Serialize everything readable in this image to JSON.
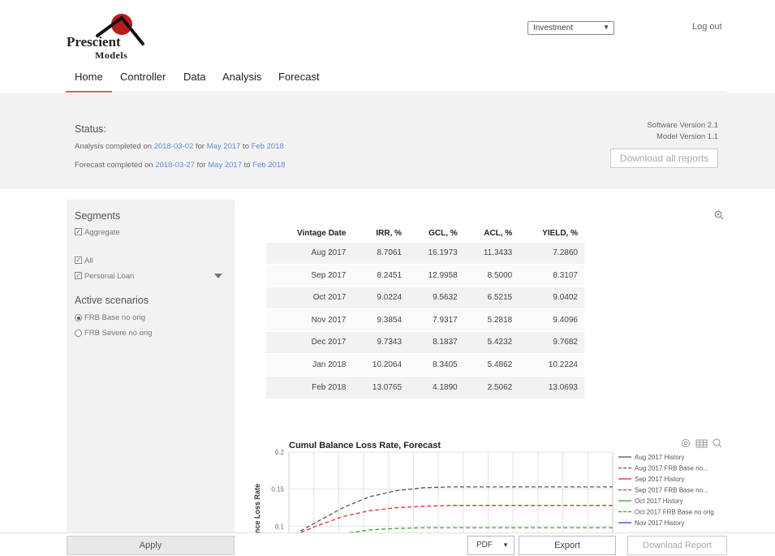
{
  "brand": {
    "name": "Prescient",
    "sub": "Models"
  },
  "header": {
    "selector_value": "Investment",
    "logout": "Log out"
  },
  "nav": {
    "items": [
      "Home",
      "Controller",
      "Data",
      "Analysis",
      "Forecast"
    ],
    "active": "Home"
  },
  "status": {
    "title": "Status:",
    "analysis": {
      "prefix": "Analysis completed on ",
      "date": "2018-03-02",
      "mid": " for ",
      "from": "May 2017",
      "to_word": " to ",
      "to": "Feb 2018"
    },
    "forecast": {
      "prefix": "Forecast completed on ",
      "date": "2018-03-27",
      "mid": " for ",
      "from": "May 2017",
      "to_word": " to ",
      "to": "Feb 2018"
    },
    "software_version": "Software Version 2.1",
    "model_version": "Model Version 1.1",
    "download_all": "Download all reports"
  },
  "sidebar": {
    "segments_title": "Segments",
    "aggregate": "Aggregate",
    "all": "All",
    "personal_loan": "Personal Loan",
    "scenarios_title": "Active scenarios",
    "scenario_base": "FRB Base no orig",
    "scenario_severe": "FRB Severe no orig"
  },
  "table": {
    "headers": [
      "Vintage Date",
      "IRR, %",
      "GCL, %",
      "ACL, %",
      "YIELD, %"
    ],
    "rows": [
      [
        "Aug 2017",
        "8.7061",
        "16.1973",
        "11.3433",
        "7.2860"
      ],
      [
        "Sep 2017",
        "8.2451",
        "12.9958",
        "8.5000",
        "8.3107"
      ],
      [
        "Oct 2017",
        "9.0224",
        "9.5632",
        "6.5215",
        "9.0402"
      ],
      [
        "Nov 2017",
        "9.3854",
        "7.9317",
        "5.2818",
        "9.4096"
      ],
      [
        "Dec 2017",
        "9.7343",
        "8.1837",
        "5.4232",
        "9.7682"
      ],
      [
        "Jan 2018",
        "10.2064",
        "8.3405",
        "5.4862",
        "10.2224"
      ],
      [
        "Feb 2018",
        "13.0765",
        "4.1890",
        "2.5062",
        "13.0693"
      ]
    ]
  },
  "chart_data": {
    "type": "line",
    "title": "Cumul Balance Loss Rate, Forecast",
    "ylabel": "nce Loss Rate",
    "yticks": [
      "0.2",
      "0.15",
      "0.1"
    ],
    "ylim": [
      0.085,
      0.2
    ],
    "legend_position": "right",
    "series": [
      {
        "name": "Aug 2017 History",
        "color": "#555555",
        "style": "solid",
        "values": []
      },
      {
        "name": "Aug 2017 FRB Base no...",
        "color": "#555555",
        "style": "dashed",
        "values": [
          0.085,
          0.105,
          0.125,
          0.14,
          0.148,
          0.152,
          0.153,
          0.153,
          0.153,
          0.153,
          0.153,
          0.153,
          0.153
        ]
      },
      {
        "name": "Sep 2017 History",
        "color": "#e03030",
        "style": "solid",
        "values": []
      },
      {
        "name": "Sep 2017 FRB Base no...",
        "color": "#e03030",
        "style": "dashed",
        "values": [
          0.085,
          0.1,
          0.113,
          0.121,
          0.125,
          0.127,
          0.128,
          0.128,
          0.128,
          0.128,
          0.128,
          0.128,
          0.128
        ]
      },
      {
        "name": "Oct 2017 History",
        "color": "#3aa03a",
        "style": "solid",
        "values": []
      },
      {
        "name": "Oct 2017 FRB Base no orig",
        "color": "#3aa03a",
        "style": "dashed",
        "values": [
          null,
          null,
          0.09,
          0.095,
          0.097,
          0.098,
          0.098,
          0.098,
          0.098,
          0.098,
          0.098,
          0.098,
          0.098
        ]
      },
      {
        "name": "Nov 2017 History",
        "color": "#3050c0",
        "style": "solid",
        "values": []
      }
    ]
  },
  "footer": {
    "apply": "Apply",
    "format": "PDF",
    "export": "Export",
    "download_report": "Download Report"
  }
}
